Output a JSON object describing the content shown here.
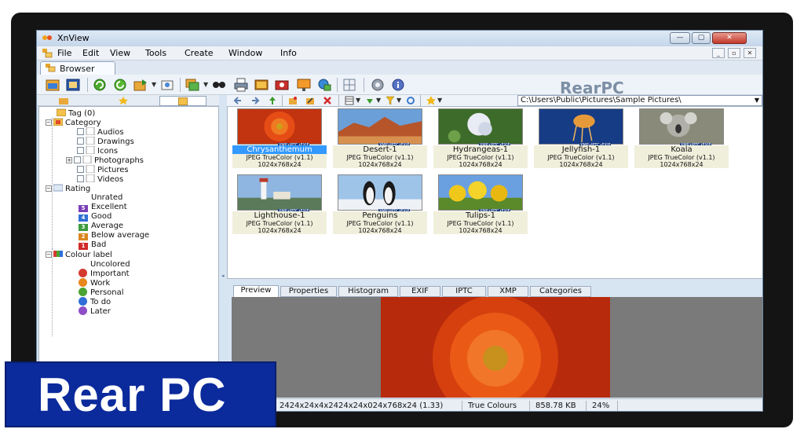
{
  "window": {
    "title": "XnView",
    "buttons": {
      "minimize": "—",
      "maximize": "▢",
      "close": "✕"
    }
  },
  "menu": {
    "items": [
      "File",
      "Edit",
      "View",
      "Tools",
      "Create",
      "Window",
      "Info"
    ],
    "mdi_buttons": [
      "_",
      "▫",
      "✕"
    ]
  },
  "tabs": {
    "browser": "Browser"
  },
  "watermark": "RearPC",
  "banner": "Rear PC",
  "toolbar": {
    "icons": [
      "open-folder-icon",
      "fullscreen-icon",
      "refresh-icon",
      "refresh-alt-icon",
      "move-to-icon",
      "convert-icon",
      "batch-icon",
      "find-icon",
      "print-icon",
      "slideshow-icon",
      "capture-icon",
      "web-page-icon",
      "globe-icon",
      "grid-icon",
      "settings-icon",
      "info-icon"
    ]
  },
  "left_tabs": [
    "folders-tab-icon",
    "favorites-tab-icon",
    "categories-tab-icon"
  ],
  "tree": {
    "tag": "Tag (0)",
    "category": "Category",
    "category_items": [
      "Audios",
      "Drawings",
      "Icons",
      "Photographs",
      "Pictures",
      "Videos"
    ],
    "rating": "Rating",
    "rating_items": [
      {
        "label": "Unrated",
        "badge": "",
        "color": ""
      },
      {
        "label": "Excellent",
        "badge": "5",
        "color": "#7a3fb8"
      },
      {
        "label": "Good",
        "badge": "4",
        "color": "#2f6fd6"
      },
      {
        "label": "Average",
        "badge": "3",
        "color": "#3d9a3d"
      },
      {
        "label": "Below average",
        "badge": "2",
        "color": "#d9861f"
      },
      {
        "label": "Bad",
        "badge": "1",
        "color": "#d12a2a"
      }
    ],
    "colour_label": "Colour label",
    "colour_items": [
      {
        "label": "Uncolored",
        "color": ""
      },
      {
        "label": "Important",
        "color": "#d43b2f"
      },
      {
        "label": "Work",
        "color": "#e8871e"
      },
      {
        "label": "Personal",
        "color": "#4aa332"
      },
      {
        "label": "To do",
        "color": "#2f6ed8"
      },
      {
        "label": "Later",
        "color": "#8d4fc7"
      }
    ]
  },
  "path": "C:\\Users\\Public\\Pictures\\Sample Pictures\\",
  "thumbnails": [
    {
      "name": "Chrysanthemum",
      "format": "JPEG TrueColor (v1.1)",
      "size": "1024x768x24",
      "selected": true
    },
    {
      "name": "Desert-1",
      "format": "JPEG TrueColor (v1.1)",
      "size": "1024x768x24",
      "selected": false
    },
    {
      "name": "Hydrangeas-1",
      "format": "JPEG TrueColor (v1.1)",
      "size": "1024x768x24",
      "selected": false
    },
    {
      "name": "Jellyfish-1",
      "format": "JPEG TrueColor (v1.1)",
      "size": "1024x768x24",
      "selected": false
    },
    {
      "name": "Koala",
      "format": "JPEG TrueColor (v1.1)",
      "size": "1024x768x24",
      "selected": false
    },
    {
      "name": "Lighthouse-1",
      "format": "JPEG TrueColor (v1.1)",
      "size": "1024x768x24",
      "selected": false
    },
    {
      "name": "Penguins",
      "format": "JPEG TrueColor (v1.1)",
      "size": "1024x768x24",
      "selected": false
    },
    {
      "name": "Tulips-1",
      "format": "JPEG TrueColor (v1.1)",
      "size": "1024x768x24",
      "selected": false
    }
  ],
  "badges": [
    "XMP",
    "IPTC",
    "EXIF"
  ],
  "preview_tabs": [
    "Preview",
    "Properties",
    "Histogram",
    "EXIF",
    "IPTC",
    "XMP",
    "Categories"
  ],
  "status": {
    "dims": "2424x24x4x2424x24x024x768x24 (1.33)",
    "colour": "True Colours",
    "filesize": "858.78 KB",
    "zoom": "24%"
  },
  "colors": {
    "selection": "#3399ff",
    "thumb_label_bg": "#f0efdc",
    "banner_bg": "#0b2a9b",
    "window_bg": "#d7e4f2"
  }
}
